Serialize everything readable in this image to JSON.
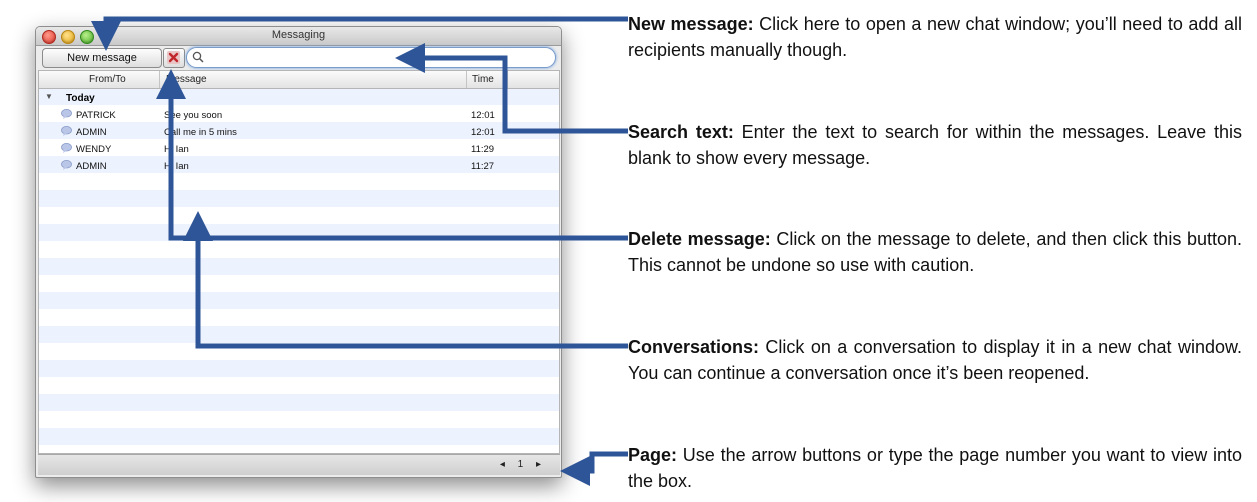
{
  "window": {
    "title": "Messaging",
    "new_message_label": "New message",
    "search_value": "",
    "columns": {
      "from_to": "From/To",
      "message": "Message",
      "time": "Time"
    },
    "group_label": "Today",
    "rows": [
      {
        "from": "PATRICK",
        "message": "See you soon",
        "time": "12:01"
      },
      {
        "from": "ADMIN",
        "message": "Call me in 5 mins",
        "time": "12:01"
      },
      {
        "from": "WENDY",
        "message": "Hi Ian",
        "time": "11:29"
      },
      {
        "from": "ADMIN",
        "message": "Hi Ian",
        "time": "11:27"
      }
    ],
    "pager": {
      "prev": "◂",
      "page": "1",
      "next": "▸"
    }
  },
  "callouts": {
    "new_message": {
      "title": "New message:",
      "text": " Click here to open a new chat window; you’ll need to add all recipients manually though."
    },
    "search": {
      "title": "Search text:",
      "text": " Enter the text to search for within the messages. Leave this blank to show every message."
    },
    "delete": {
      "title": "Delete message:",
      "text": " Click on the message to delete, and then click this button. This cannot be undone so use with caution."
    },
    "conversations": {
      "title": "Conversations:",
      "text": " Click on a conversation to display it in a new chat window. You can continue a conversation once it’s been reopened."
    },
    "page": {
      "title": "Page:",
      "text": " Use the arrow buttons or type the page number you want to view into the box."
    }
  },
  "colors": {
    "arrow": "#2e5597",
    "row_stripe": "#edf3fe",
    "search_focus": "#6ea0e0"
  }
}
